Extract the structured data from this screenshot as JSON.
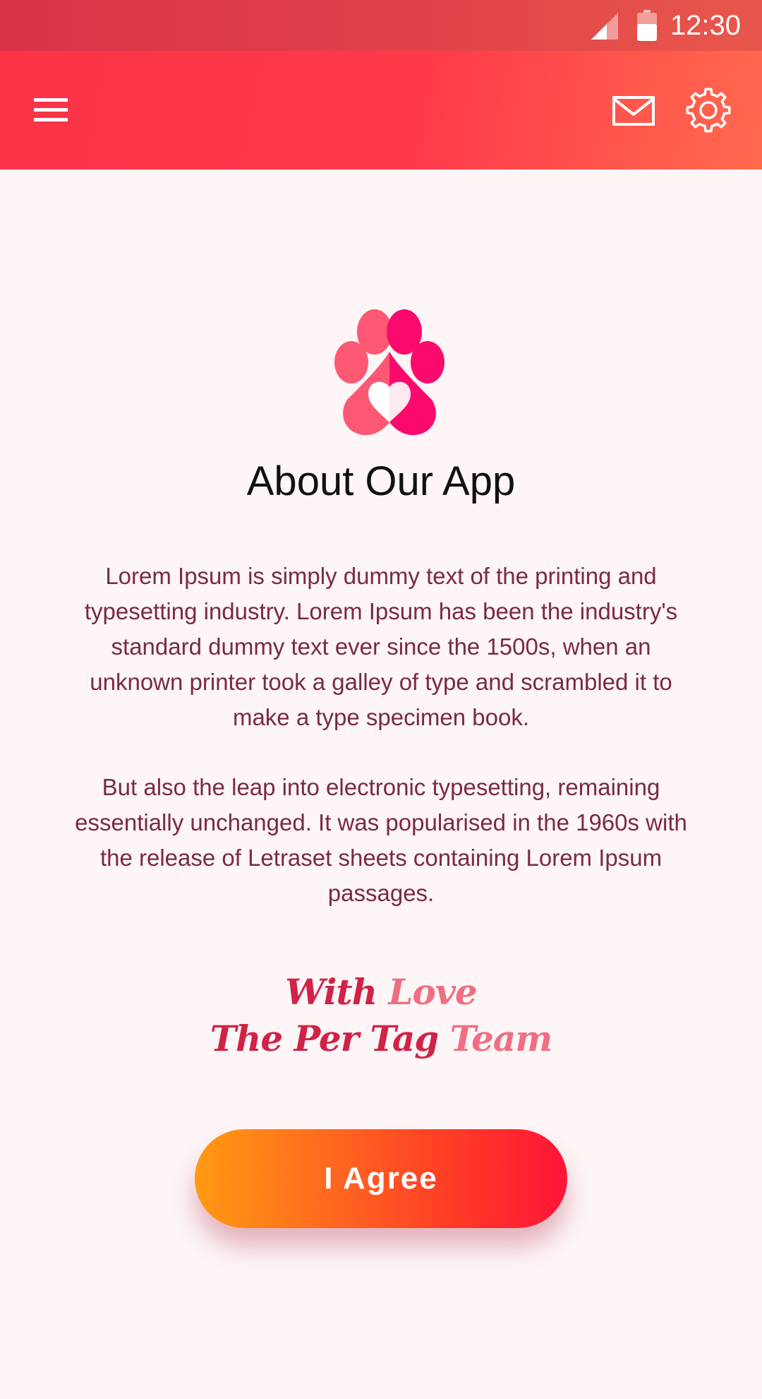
{
  "status_bar": {
    "time": "12:30",
    "icons": [
      "signal-icon",
      "battery-icon"
    ]
  },
  "app_bar": {
    "icons": [
      "menu-icon",
      "mail-icon",
      "gear-icon"
    ]
  },
  "content": {
    "logo_icon": "paw-heart-icon",
    "title": "About Our App",
    "paragraph_1": "Lorem Ipsum is simply dummy text of the printing and typesetting industry. Lorem Ipsum has been the industry's standard dummy text ever since the 1500s, when an unknown printer took a galley of type and scrambled it to make a type specimen book.",
    "paragraph_2": "But also the leap into electronic typesetting, remaining essentially unchanged. It was popularised in the 1960s with the release of Letraset sheets containing Lorem Ipsum passages.",
    "signature": {
      "line1_part1": "With",
      "line1_part2": "Love",
      "line2_part1": "The Per",
      "line2_part2": "Tag",
      "line2_part3": "Team"
    }
  },
  "agree_button": {
    "label": "I Agree"
  },
  "colors": {
    "app_bar": "#fe3a4a",
    "status_bar": "#d83346",
    "background": "#fdf5f6",
    "body_text": "#7b2943",
    "button_start": "#ff9a12",
    "button_end": "#ff1438"
  }
}
